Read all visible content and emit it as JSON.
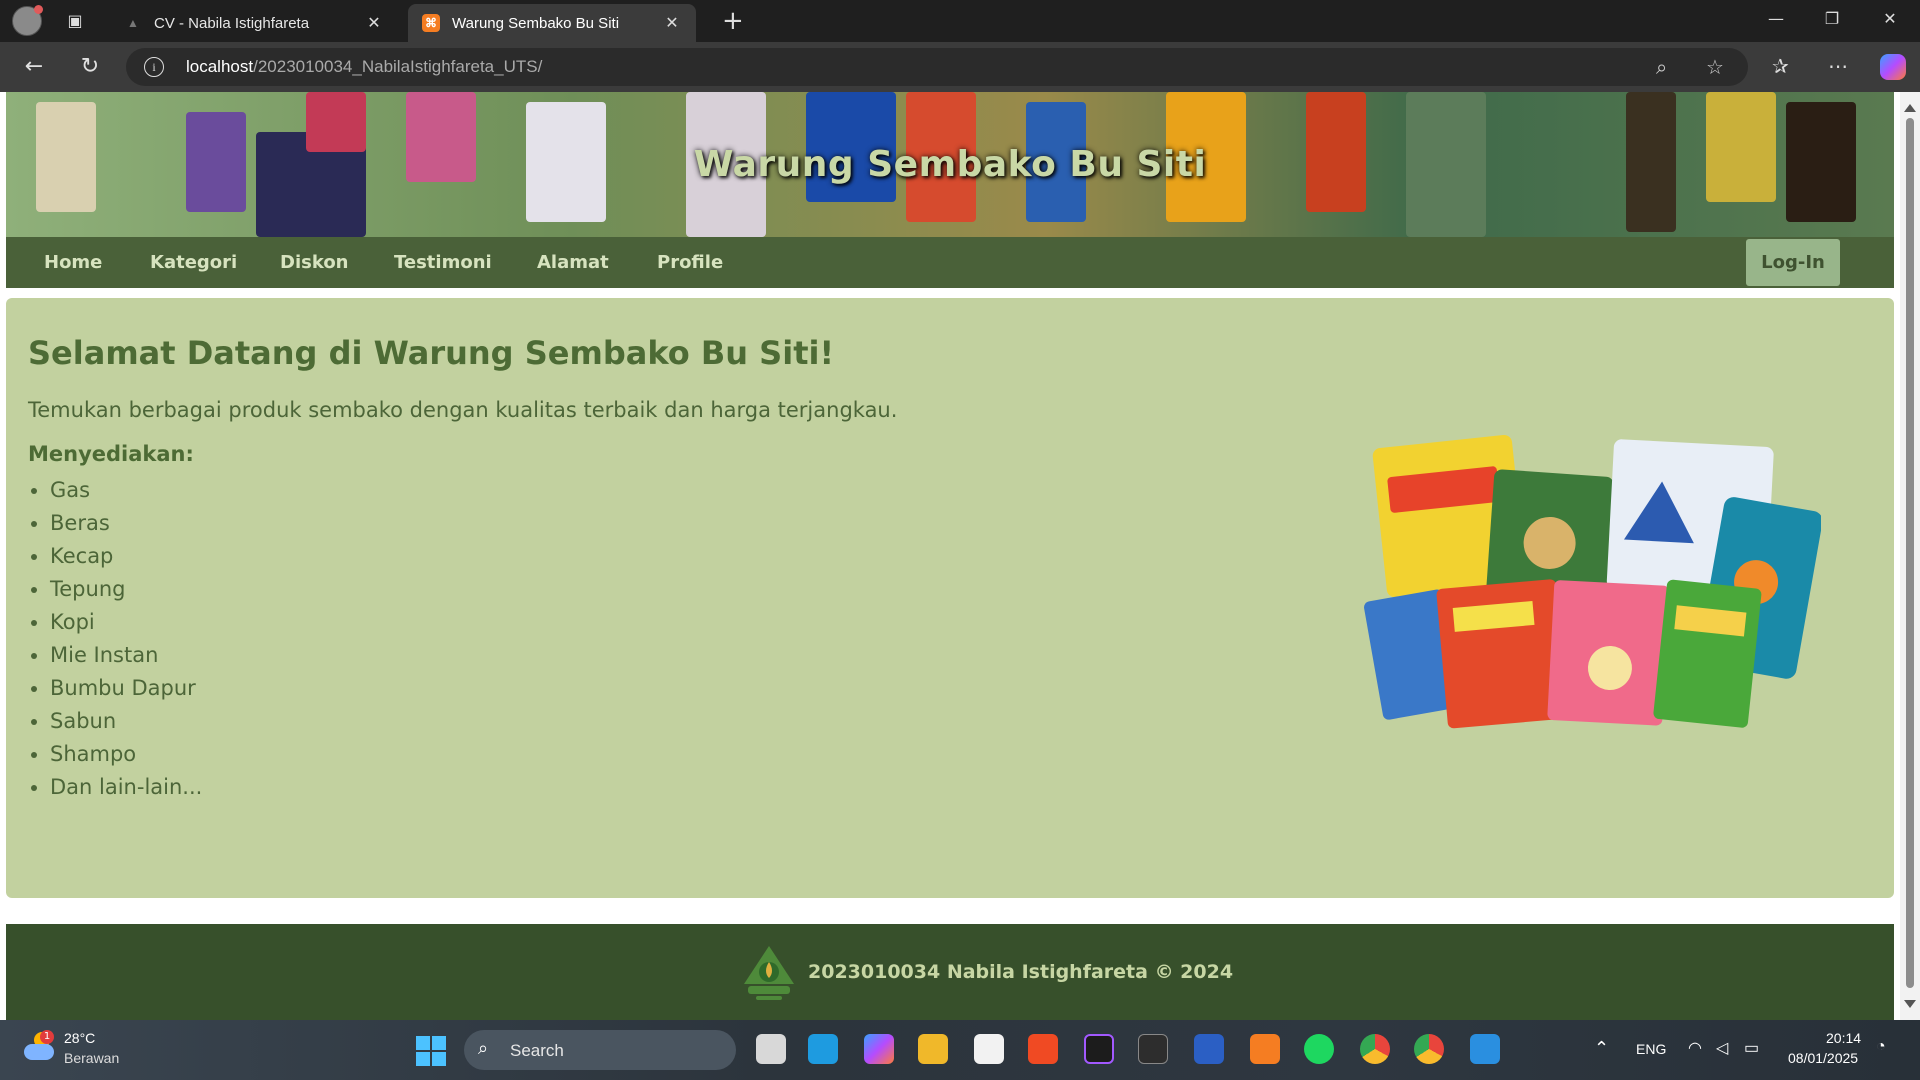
{
  "browser": {
    "tabs": [
      {
        "title": "CV - Nabila Istighfareta",
        "active": false
      },
      {
        "title": "Warung Sembako Bu Siti",
        "active": true
      }
    ],
    "url_host": "localhost",
    "url_path": "/2023010034_NabilaIstighfareta_UTS/"
  },
  "site": {
    "banner_title": "Warung Sembako Bu Siti",
    "nav": [
      "Home",
      "Kategori",
      "Diskon",
      "Testimoni",
      "Alamat",
      "Profile"
    ],
    "login_label": "Log-In",
    "heading": "Selamat Datang di Warung Sembako Bu Siti!",
    "intro": "Temukan berbagai produk sembako dengan kualitas terbaik dan harga terjangkau.",
    "provides_label": "Menyediakan:",
    "items": [
      "Gas",
      "Beras",
      "Kecap",
      "Tepung",
      "Kopi",
      "Mie Instan",
      "Bumbu Dapur",
      "Sabun",
      "Shampo",
      "Dan lain-lain..."
    ],
    "footer_text": "2023010034 Nabila Istighfareta © 2024"
  },
  "taskbar": {
    "weather_badge": "1",
    "temperature": "28°C",
    "condition": "Berawan",
    "search_label": "Search",
    "language": "ENG",
    "time": "20:14",
    "date": "08/01/2025"
  },
  "colors": {
    "nav_bg": "#4a6139",
    "content_bg": "#c2d19f",
    "footer_bg": "#37502b",
    "heading": "#4d6b35",
    "login_bg": "#98b58a"
  }
}
